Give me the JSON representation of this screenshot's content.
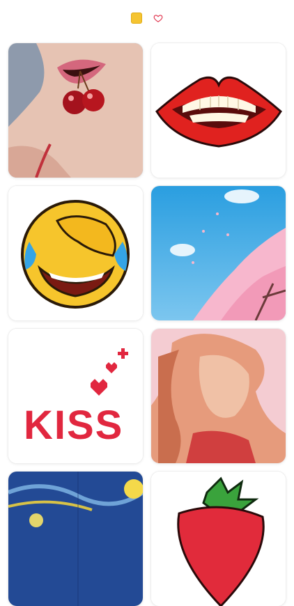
{
  "header": {
    "palette_icon": "yellow-square-icon",
    "favorites_icon": "heart-outline-icon",
    "accent": "#f5c431",
    "heart_color": "#e0314b"
  },
  "gallery": {
    "items": [
      {
        "name": "lips-cherries-photo",
        "text": ""
      },
      {
        "name": "pixel-red-lips",
        "text": ""
      },
      {
        "name": "pixel-laughing-emoji",
        "text": ""
      },
      {
        "name": "sakura-sky",
        "text": ""
      },
      {
        "name": "kiss-hearts",
        "text": "KISS"
      },
      {
        "name": "woman-portrait",
        "text": ""
      },
      {
        "name": "starry-night",
        "text": ""
      },
      {
        "name": "pixel-strawberry",
        "text": ""
      }
    ]
  }
}
